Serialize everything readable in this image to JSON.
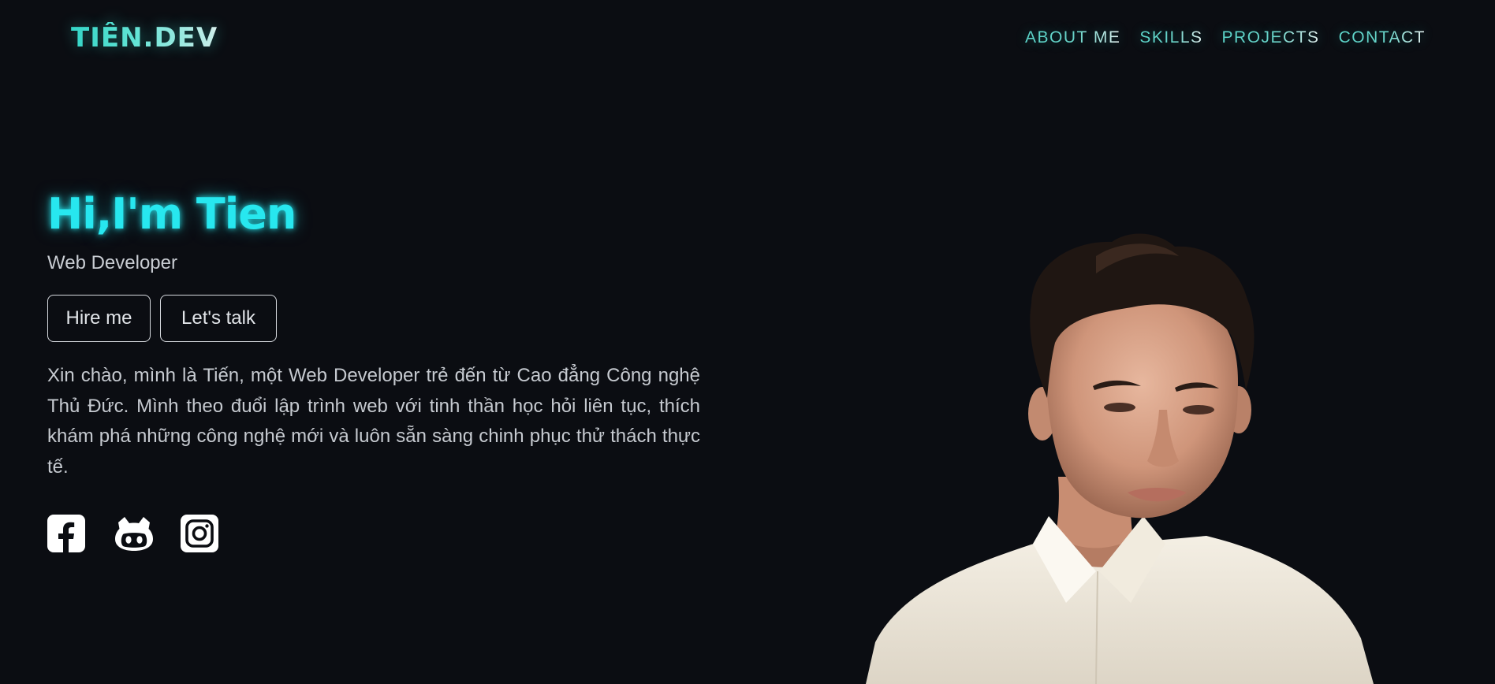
{
  "header": {
    "logo": "TIẾN.DEV",
    "nav": [
      "ABOUT ME",
      "SKILLS",
      "PROJECTS",
      "CONTACT"
    ]
  },
  "hero": {
    "title": "Hi,I'm Tien",
    "role": "Web Developer",
    "buttons": {
      "hire": "Hire me",
      "talk": "Let's talk"
    },
    "intro": "Xin chào, mình là Tiến, một Web Developer trẻ đến từ Cao đẳng Công nghệ Thủ Đức. Mình theo đuổi lập trình web với tinh thần học hỏi liên tục, thích khám phá những công nghệ mới và luôn sẵn sàng chinh phục thử thách thực tế."
  },
  "social": [
    {
      "icon": "facebook-icon"
    },
    {
      "icon": "github-icon"
    },
    {
      "icon": "instagram-icon"
    }
  ],
  "colors": {
    "background": "#0b0d12",
    "accent": "#27e7ef",
    "logo_gradient_start": "#35d6c8",
    "text": "#c6cad0"
  }
}
